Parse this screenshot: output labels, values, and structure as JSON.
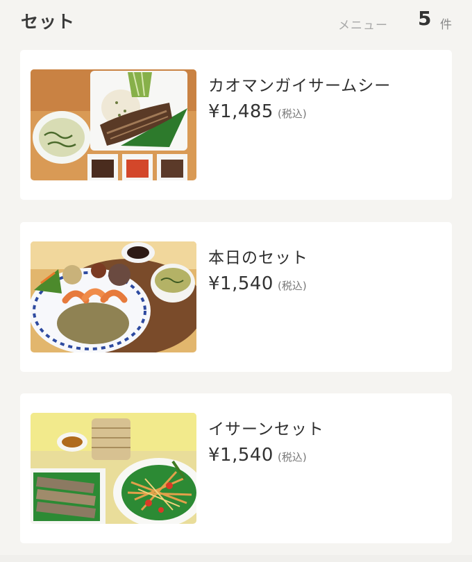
{
  "header": {
    "section_title": "セット",
    "menu_label": "メニュー",
    "count": "5",
    "count_unit": "件"
  },
  "items": [
    {
      "name": "カオマンガイサームシー",
      "price": "¥1,485",
      "tax_note": "(税込)",
      "image_icon": "khao-man-gai-plate-photo"
    },
    {
      "name": "本日のセット",
      "price": "¥1,540",
      "tax_note": "(税込)",
      "image_icon": "shrimp-fried-rice-set-photo"
    },
    {
      "name": "イサーンセット",
      "price": "¥1,540",
      "tax_note": "(税込)",
      "image_icon": "isaan-grilled-chicken-salad-photo"
    }
  ],
  "colors": {
    "background": "#f5f4f1",
    "card": "#ffffff",
    "text": "#333333",
    "muted": "#a8a8a8"
  }
}
